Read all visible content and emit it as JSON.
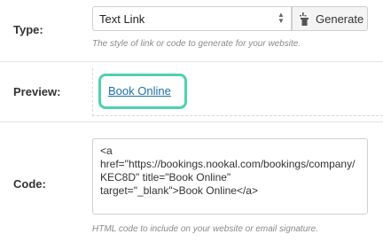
{
  "type_row": {
    "label": "Type:",
    "select_value": "Text Link",
    "generate_label": "Generate",
    "help": "The style of link or code to generate for your website."
  },
  "preview_row": {
    "label": "Preview:",
    "link_text": "Book Online"
  },
  "code_row": {
    "label": "Code:",
    "code": "<a\nhref=\"https://bookings.nookal.com/bookings/company/KEC8D\" title=\"Book Online\"\ntarget=\"_blank\">Book Online</a>",
    "help": "HTML code to include on your website or email signature."
  },
  "colors": {
    "highlight": "#4fd1ad",
    "link": "#1a6fa8"
  }
}
